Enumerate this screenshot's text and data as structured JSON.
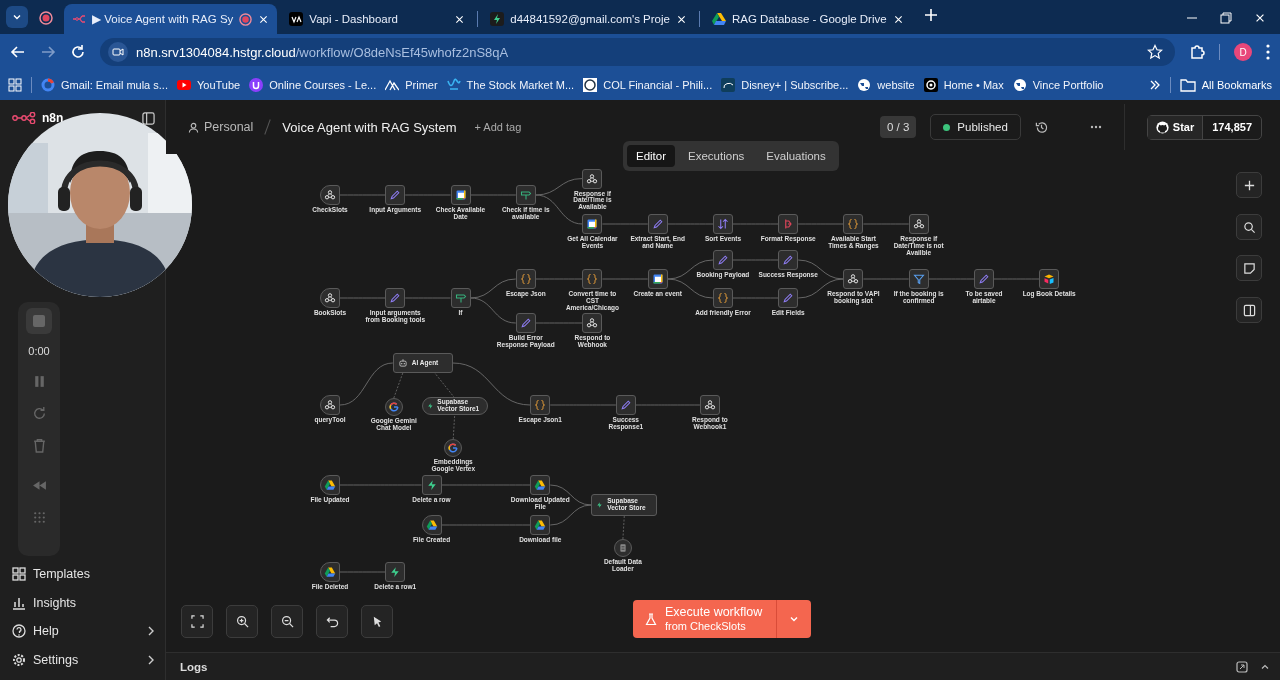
{
  "browser": {
    "tabs": [
      {
        "title": "▶ Voice Agent with RAG Sy",
        "selected": true,
        "recording": true
      },
      {
        "title": "Vapi - Dashboard",
        "selected": false,
        "recording": false
      },
      {
        "title": "d44841592@gmail.com's Proje",
        "selected": false,
        "recording": false
      },
      {
        "title": "RAG Database - Google Drive",
        "selected": false,
        "recording": false
      }
    ],
    "url_host": "n8n.srv1304084.hstgr.cloud",
    "url_path": "/workflow/O8deNsEf45whofz2nS8qA",
    "profile_initial": "D",
    "bookmarks": [
      {
        "label": "Gmail: Email mula s..."
      },
      {
        "label": "YouTube"
      },
      {
        "label": "Online Courses - Le..."
      },
      {
        "label": "Primer"
      },
      {
        "label": "The Stock Market M..."
      },
      {
        "label": "COL Financial - Phili..."
      },
      {
        "label": "Disney+ | Subscribe..."
      },
      {
        "label": "website"
      },
      {
        "label": "Home • Max"
      },
      {
        "label": "Vince Portfolio"
      }
    ],
    "all_bookmarks": "All Bookmarks"
  },
  "recorder": {
    "time": "0:00"
  },
  "sidebar": {
    "brand": "n8n",
    "items": [
      {
        "label": "Templates",
        "has_submenu": false
      },
      {
        "label": "Insights",
        "has_submenu": false
      },
      {
        "label": "Help",
        "has_submenu": true
      },
      {
        "label": "Settings",
        "has_submenu": true
      }
    ]
  },
  "header": {
    "project": "Personal",
    "workflow_name": "Voice Agent with RAG System",
    "add_tag": "+ Add tag",
    "counter": "0 / 3",
    "status": "Published",
    "published": true,
    "github_label": "Star",
    "github_count": "174,857"
  },
  "view_tabs": [
    {
      "label": "Editor",
      "selected": true
    },
    {
      "label": "Executions",
      "selected": false
    },
    {
      "label": "Evaluations",
      "selected": false
    }
  ],
  "nodes": [
    {
      "label": "CheckSlots",
      "kind": "webhook_trigger"
    },
    {
      "label": "Input Arguments",
      "kind": "set"
    },
    {
      "label": "Check Available Date",
      "kind": "calendar"
    },
    {
      "label": "Check if time is available",
      "kind": "if"
    },
    {
      "label": "Response if Date/Time is Available",
      "kind": "respond"
    },
    {
      "label": "Get All Calendar Events",
      "kind": "calendar"
    },
    {
      "label": "Extract Start, End and Name",
      "kind": "set"
    },
    {
      "label": "Sort Events",
      "kind": "sort"
    },
    {
      "label": "Format Response",
      "kind": "format"
    },
    {
      "label": "Available Start Times & Ranges",
      "kind": "code"
    },
    {
      "label": "Response if Date/Time is not Availble",
      "kind": "respond"
    },
    {
      "label": "BookSlots",
      "kind": "webhook_trigger"
    },
    {
      "label": "Input arguments from Booking tools",
      "kind": "set"
    },
    {
      "label": "If",
      "kind": "if"
    },
    {
      "label": "Escape Json",
      "kind": "code"
    },
    {
      "label": "Convert time to CST America/Chicago",
      "kind": "code"
    },
    {
      "label": "Create an event",
      "kind": "calendar"
    },
    {
      "label": "Booking Payload",
      "kind": "set"
    },
    {
      "label": "Success Response",
      "kind": "set"
    },
    {
      "label": "Add friendly Error",
      "kind": "code"
    },
    {
      "label": "Edit Fields",
      "kind": "set"
    },
    {
      "label": "Respond to VAPI booking slot",
      "kind": "respond"
    },
    {
      "label": "If the booking is confirmed",
      "kind": "filter"
    },
    {
      "label": "To be saved airtable",
      "kind": "set"
    },
    {
      "label": "Log Book Details",
      "kind": "airtable"
    },
    {
      "label": "Build Error Response Payload",
      "kind": "set"
    },
    {
      "label": "Respond to Webhook",
      "kind": "respond"
    },
    {
      "label": "AI Agent",
      "kind": "agent"
    },
    {
      "label": "queryTool",
      "kind": "webhook_trigger"
    },
    {
      "label": "Google Gemini Chat Model",
      "kind": "gemini"
    },
    {
      "label": "Supabase Vector Store1",
      "kind": "vector_tool"
    },
    {
      "label": "Escape Json1",
      "kind": "code"
    },
    {
      "label": "Success Response1",
      "kind": "set"
    },
    {
      "label": "Respond to Webhook1",
      "kind": "respond"
    },
    {
      "label": "Embeddings Google Vertex",
      "kind": "gemini"
    },
    {
      "label": "File Updated",
      "kind": "drive_trigger"
    },
    {
      "label": "Delete a row",
      "kind": "supabase"
    },
    {
      "label": "Download Updated File",
      "kind": "drive"
    },
    {
      "label": "Supabase Vector Store",
      "kind": "vector_store"
    },
    {
      "label": "File Created",
      "kind": "drive_trigger"
    },
    {
      "label": "Download file",
      "kind": "drive"
    },
    {
      "label": "Default Data Loader",
      "kind": "loader"
    },
    {
      "label": "File Deleted",
      "kind": "drive_trigger"
    },
    {
      "label": "Delete a row1",
      "kind": "supabase"
    }
  ],
  "execute_button": {
    "label": "Execute workflow",
    "sublabel": "from CheckSlots"
  },
  "logs": {
    "label": "Logs"
  }
}
